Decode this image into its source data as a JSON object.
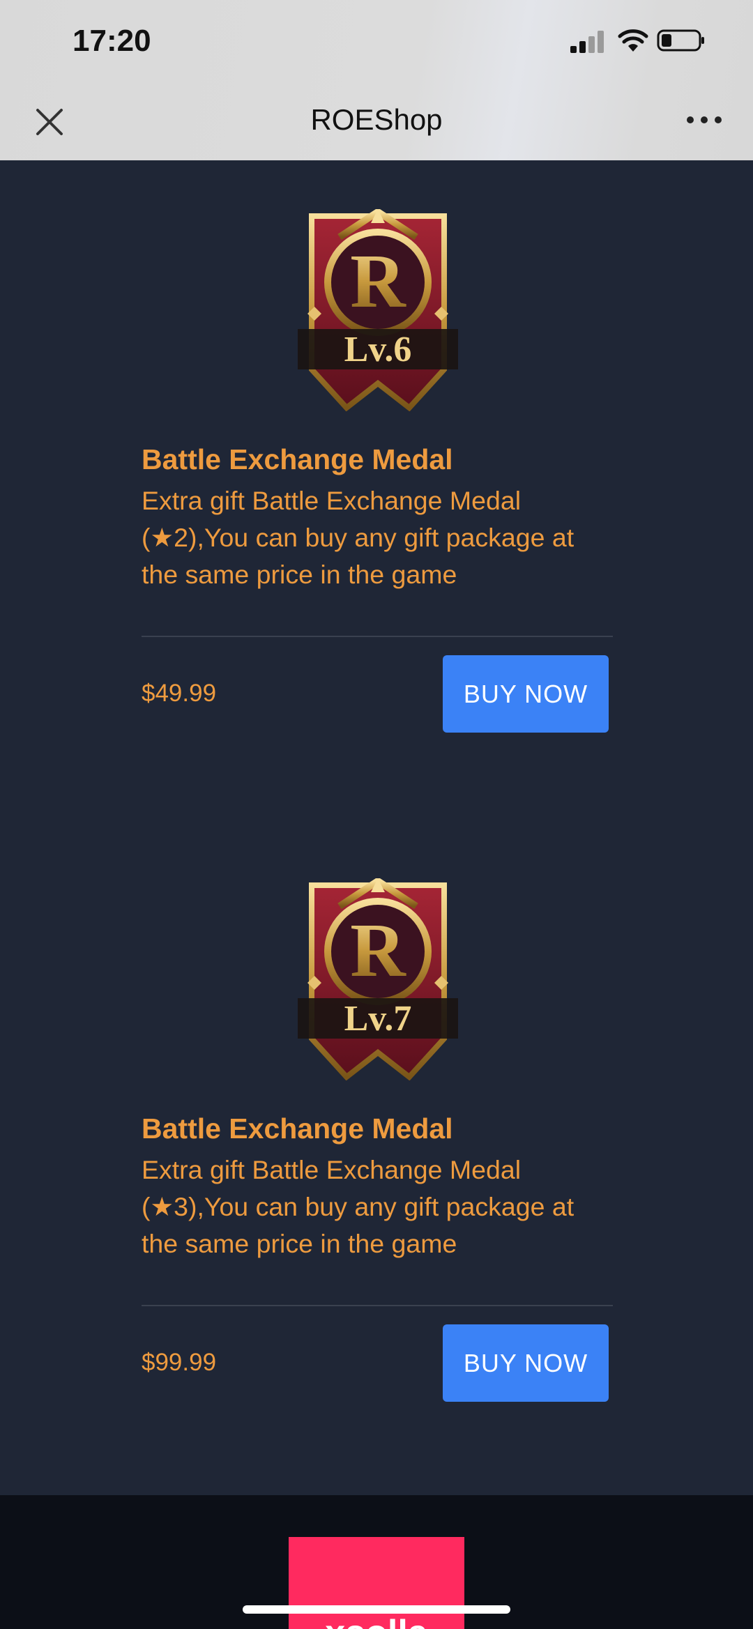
{
  "status_bar": {
    "time": "17:20",
    "icons": [
      "cellular-signal-icon",
      "wifi-icon",
      "battery-icon"
    ]
  },
  "nav": {
    "title": "ROEShop",
    "left_icon": "close-icon",
    "right_icon": "more-icon"
  },
  "colors": {
    "page_bg": "#1f2636",
    "accent_text": "#ee9b3f",
    "button_bg": "#3b82f6",
    "footer_bg": "#0c0f17",
    "brand_pink": "#ff2a5f"
  },
  "products": [
    {
      "badge_text": "Lv.6",
      "title": "Battle Exchange Medal",
      "description": "Extra gift Battle Exchange Medal (★2),You can buy any gift package at the same price in the game",
      "price": "$49.99",
      "button_label": "BUY NOW"
    },
    {
      "badge_text": "Lv.7",
      "title": "Battle Exchange Medal",
      "description": "Extra gift Battle Exchange Medal (★3),You can buy any gift package at the same price in the game",
      "price": "$99.99",
      "button_label": "BUY NOW"
    }
  ],
  "footer": {
    "logo_text": "xsolla"
  }
}
